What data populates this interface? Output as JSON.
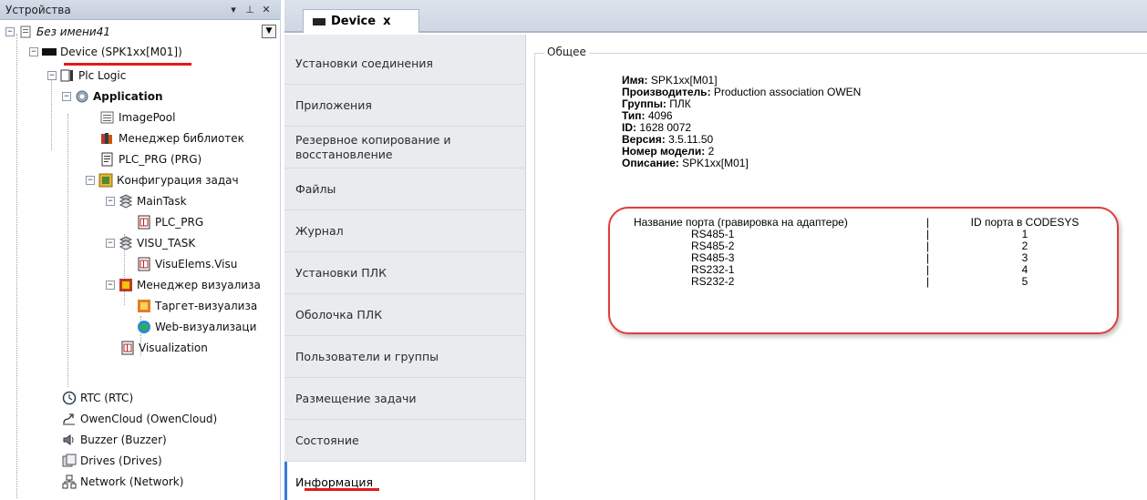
{
  "devices_panel": {
    "title": "Устройства",
    "controls": {
      "dropdown": "▾",
      "pin": "⊥",
      "close": "✕"
    },
    "tree": [
      {
        "label": "Без имени41",
        "style": "italic",
        "icon": "project-icon"
      },
      {
        "label": "Device (SPK1xx[M01])",
        "icon": "device-icon"
      },
      {
        "label": "Plc Logic",
        "icon": "plc-logic-icon"
      },
      {
        "label": "Application",
        "style": "bold",
        "icon": "application-gear-icon"
      },
      {
        "label": "ImagePool",
        "icon": "image-pool-icon"
      },
      {
        "label": "Менеджер библиотек",
        "icon": "library-manager-icon"
      },
      {
        "label": "PLC_PRG (PRG)",
        "icon": "program-icon"
      },
      {
        "label": "Конфигурация задач",
        "icon": "task-config-icon"
      },
      {
        "label": "MainTask",
        "icon": "task-icon"
      },
      {
        "label": "PLC_PRG",
        "icon": "program-call-icon"
      },
      {
        "label": "VISU_TASK",
        "icon": "task-icon"
      },
      {
        "label": "VisuElems.Visu",
        "icon": "program-call-icon"
      },
      {
        "label": "Менеджер визуализа",
        "icon": "visu-manager-icon"
      },
      {
        "label": "Таргет-визуализа",
        "icon": "target-visu-icon"
      },
      {
        "label": "Web-визуализаци",
        "icon": "web-visu-icon"
      },
      {
        "label": "Visualization",
        "icon": "visualization-icon"
      },
      {
        "label": "RTC (RTC)",
        "icon": "clock-icon"
      },
      {
        "label": "OwenCloud (OwenCloud)",
        "icon": "cloud-icon"
      },
      {
        "label": "Buzzer (Buzzer)",
        "icon": "speaker-icon"
      },
      {
        "label": "Drives (Drives)",
        "icon": "drives-icon"
      },
      {
        "label": "Network (Network)",
        "icon": "network-icon"
      }
    ]
  },
  "editor": {
    "tab_label": "Device",
    "tab_close": "x",
    "nav": [
      "Установки соединения",
      "Приложения",
      "Резервное копирование и восстановление",
      "Файлы",
      "Журнал",
      "Установки ПЛК",
      "Оболочка ПЛК",
      "Пользователи и группы",
      "Размещение задачи",
      "Состояние",
      "Информация"
    ],
    "active_nav": "Информация",
    "group_title": "Общее",
    "info": [
      {
        "label": "Имя:",
        "value": "SPK1xx[M01]"
      },
      {
        "label": "Производитель:",
        "value": "Production association OWEN"
      },
      {
        "label": "Группы:",
        "value": "ПЛК"
      },
      {
        "label": "Тип:",
        "value": "4096"
      },
      {
        "label": "ID:",
        "value": "1628 0072"
      },
      {
        "label": "Версия:",
        "value": "3.5.11.50"
      },
      {
        "label": "Номер модели:",
        "value": "2"
      },
      {
        "label": "Описание:",
        "value": "SPK1xx[M01]"
      }
    ],
    "ports_table": {
      "header_name": "Название порта (гравировка на адаптере)",
      "header_separator": "|",
      "header_id": "ID порта в CODESYS",
      "rows": [
        {
          "name": "RS485-1",
          "sep": "|",
          "id": "1"
        },
        {
          "name": "RS485-2",
          "sep": "|",
          "id": "2"
        },
        {
          "name": "RS485-3",
          "sep": "|",
          "id": "3"
        },
        {
          "name": "RS232-1",
          "sep": "|",
          "id": "4"
        },
        {
          "name": "RS232-2",
          "sep": "|",
          "id": "5"
        }
      ]
    },
    "highlight_color": "#e23b3b",
    "accent_color": "#3a7bd5"
  }
}
